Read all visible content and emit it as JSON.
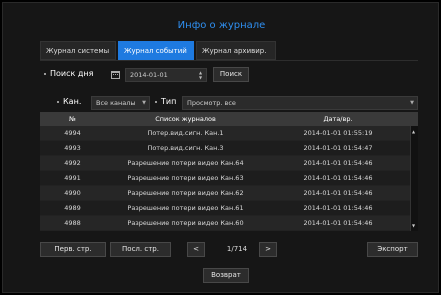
{
  "window": {
    "title": "Инфо о журнале"
  },
  "tabs": [
    {
      "label": "Журнал системы",
      "active": false
    },
    {
      "label": "Журнал событий",
      "active": true
    },
    {
      "label": "Журнал архивир.",
      "active": false
    }
  ],
  "search": {
    "day_label": "Поиск дня",
    "date_value": "2014-01-01",
    "search_button": "Поиск",
    "channel_label": "Кан.",
    "channel_value": "Все каналы",
    "type_label": "Тип",
    "type_value": "Просмотр. все"
  },
  "table": {
    "headers": [
      "№",
      "Список журналов",
      "Дата/вр."
    ],
    "rows": [
      {
        "num": "4994",
        "event": "Потер.вид.сигн. Кан.1",
        "datetime": "2014-01-01 01:55:19"
      },
      {
        "num": "4993",
        "event": "Потер.вид.сигн. Кан.3",
        "datetime": "2014-01-01 01:54:47"
      },
      {
        "num": "4992",
        "event": "Разрешение потери видео Кан.64",
        "datetime": "2014-01-01 01:54:46"
      },
      {
        "num": "4991",
        "event": "Разрешение потери видео Кан.63",
        "datetime": "2014-01-01 01:54:46"
      },
      {
        "num": "4990",
        "event": "Разрешение потери видео Кан.62",
        "datetime": "2014-01-01 01:54:46"
      },
      {
        "num": "4989",
        "event": "Разрешение потери видео Кан.61",
        "datetime": "2014-01-01 01:54:46"
      },
      {
        "num": "4988",
        "event": "Разрешение потери видео Кан.60",
        "datetime": "2014-01-01 01:54:46"
      }
    ]
  },
  "pagination": {
    "first_label": "Перв. стр.",
    "last_label": "Посл. стр.",
    "prev_icon": "<",
    "next_icon": ">",
    "page_text": "1/714",
    "export_label": "Экспорт"
  },
  "footer": {
    "back_label": "Возврат"
  },
  "colors": {
    "accent": "#1e7ae0",
    "title": "#2f8ff0",
    "background": "#161616"
  },
  "icons": {
    "calendar": "calendar-icon",
    "stepper": "stepper-icon",
    "dropdown": "chevron-down-icon",
    "scroll_up": "scroll-up-icon",
    "scroll_down": "scroll-down-icon"
  }
}
